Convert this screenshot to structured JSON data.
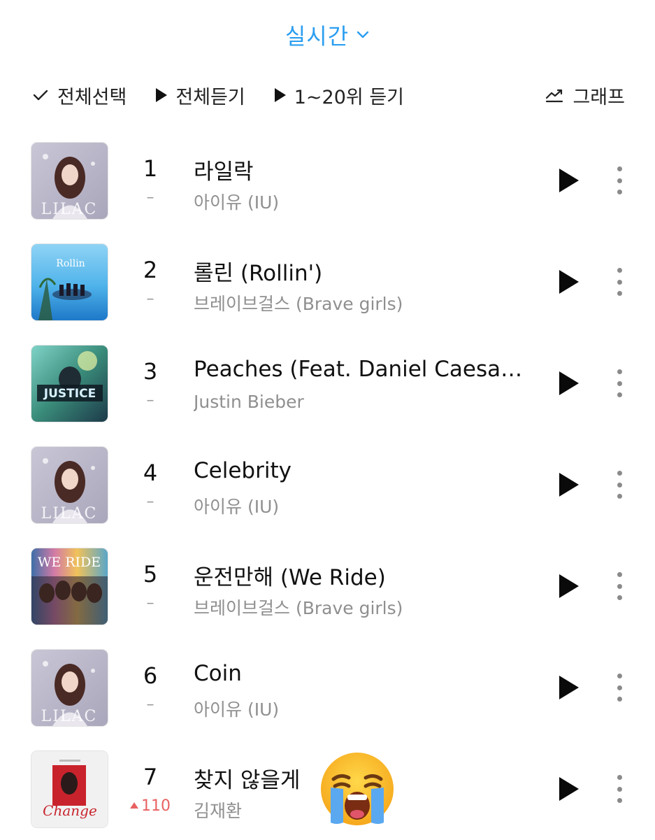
{
  "header": {
    "title": "실시간",
    "dropdown_icon": "chevron-down-icon",
    "accent_color": "#2b9ef0"
  },
  "toolbar": {
    "select_all": "전체선택",
    "play_all": "전체듣기",
    "play_top20": "1~20위 듣기",
    "graph": "그래프"
  },
  "chart": [
    {
      "rank": "1",
      "change": "–",
      "change_type": "same",
      "title": "라일락",
      "artist": "아이유 (IU)",
      "album": "LILAC"
    },
    {
      "rank": "2",
      "change": "–",
      "change_type": "same",
      "title": "롤린 (Rollin')",
      "artist": "브레이브걸스 (Brave girls)",
      "album": "Rollin"
    },
    {
      "rank": "3",
      "change": "–",
      "change_type": "same",
      "title": "Peaches (Feat. Daniel Caesar…",
      "artist": "Justin Bieber",
      "album": "JUSTICE"
    },
    {
      "rank": "4",
      "change": "–",
      "change_type": "same",
      "title": "Celebrity",
      "artist": "아이유 (IU)",
      "album": "LILAC"
    },
    {
      "rank": "5",
      "change": "–",
      "change_type": "same",
      "title": "운전만해 (We Ride)",
      "artist": "브레이브걸스 (Brave girls)",
      "album": "WE RIDE"
    },
    {
      "rank": "6",
      "change": "–",
      "change_type": "same",
      "title": "Coin",
      "artist": "아이유 (IU)",
      "album": "LILAC"
    },
    {
      "rank": "7",
      "change": "110",
      "change_type": "up",
      "title": "찾지 않을게",
      "artist": "김재환",
      "album": "Change"
    }
  ],
  "overlay": {
    "emoji": "loudly-crying-face-icon"
  }
}
